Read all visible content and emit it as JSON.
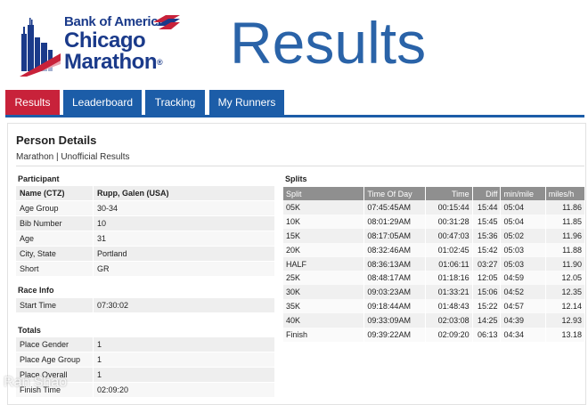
{
  "brand": {
    "sponsor": "Bank of America",
    "line1": "Chicago",
    "line2": "Marathon",
    "registered": "®"
  },
  "page_title": "Results",
  "nav": {
    "items": [
      {
        "label": "Results",
        "active": true
      },
      {
        "label": "Leaderboard",
        "active": false
      },
      {
        "label": "Tracking",
        "active": false
      },
      {
        "label": "My Runners",
        "active": false
      }
    ]
  },
  "person": {
    "heading": "Person Details",
    "subtitle": "Marathon | Unofficial Results"
  },
  "participant": {
    "title": "Participant",
    "rows": [
      {
        "k": "Name (CTZ)",
        "v": "Rupp, Galen (USA)"
      },
      {
        "k": "Age Group",
        "v": "30-34"
      },
      {
        "k": "Bib Number",
        "v": "10"
      },
      {
        "k": "Age",
        "v": "31"
      },
      {
        "k": "City, State",
        "v": "Portland"
      },
      {
        "k": "Short",
        "v": "GR"
      }
    ]
  },
  "race_info": {
    "title": "Race Info",
    "rows": [
      {
        "k": "Start Time",
        "v": "07:30:02"
      }
    ]
  },
  "totals": {
    "title": "Totals",
    "rows": [
      {
        "k": "Place Gender",
        "v": "1"
      },
      {
        "k": "Place Age Group",
        "v": "1"
      },
      {
        "k": "Place Overall",
        "v": "1"
      },
      {
        "k": "Finish Time",
        "v": "02:09:20"
      }
    ]
  },
  "splits": {
    "title": "Splits",
    "columns": [
      "Split",
      "Time Of Day",
      "Time",
      "Diff",
      "min/mile",
      "miles/h"
    ],
    "rows": [
      [
        "05K",
        "07:45:45AM",
        "00:15:44",
        "15:44",
        "05:04",
        "11.86"
      ],
      [
        "10K",
        "08:01:29AM",
        "00:31:28",
        "15:45",
        "05:04",
        "11.85"
      ],
      [
        "15K",
        "08:17:05AM",
        "00:47:03",
        "15:36",
        "05:02",
        "11.96"
      ],
      [
        "20K",
        "08:32:46AM",
        "01:02:45",
        "15:42",
        "05:03",
        "11.88"
      ],
      [
        "HALF",
        "08:36:13AM",
        "01:06:11",
        "03:27",
        "05:03",
        "11.90"
      ],
      [
        "25K",
        "08:48:17AM",
        "01:18:16",
        "12:05",
        "04:59",
        "12.05"
      ],
      [
        "30K",
        "09:03:23AM",
        "01:33:21",
        "15:06",
        "04:52",
        "12.35"
      ],
      [
        "35K",
        "09:18:44AM",
        "01:48:43",
        "15:22",
        "04:57",
        "12.14"
      ],
      [
        "40K",
        "09:33:09AM",
        "02:03:08",
        "14:25",
        "04:39",
        "12.93"
      ],
      [
        "Finish",
        "09:39:22AM",
        "02:09:20",
        "06:13",
        "04:34",
        "13.18"
      ]
    ]
  },
  "watermark": "Ran Shao",
  "colors": {
    "nav_active": "#c8223a",
    "nav_default": "#1c5da8",
    "title": "#2a63a8",
    "brand": "#1a3a8a",
    "splits_header": "#8f8f8f"
  }
}
